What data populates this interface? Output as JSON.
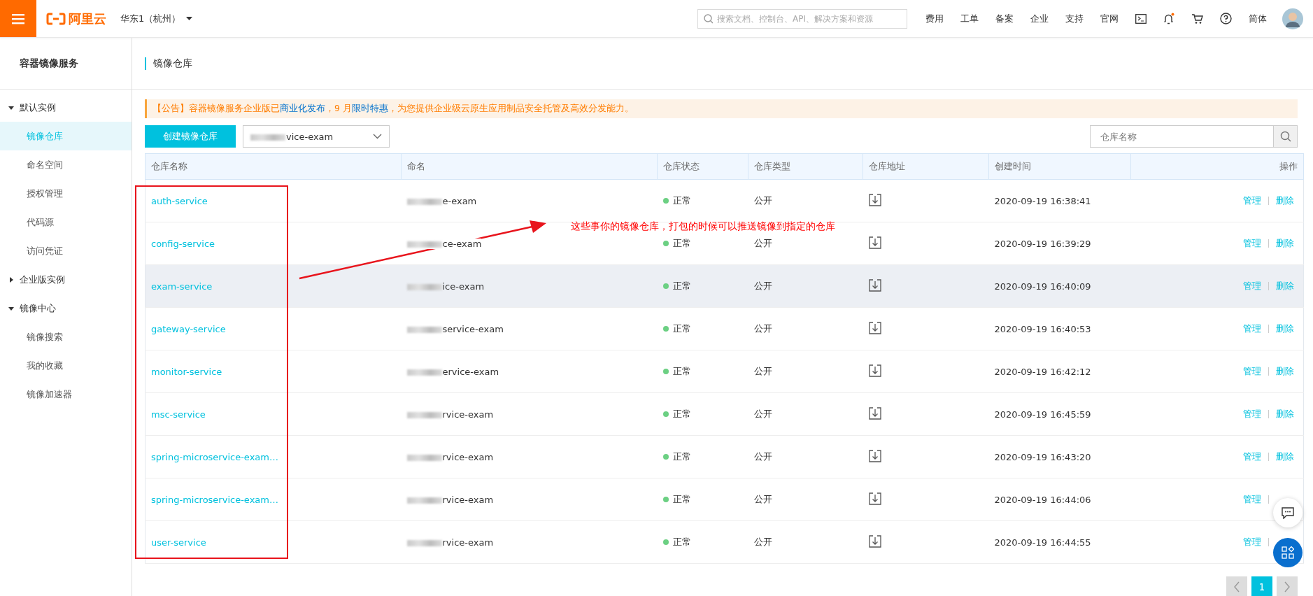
{
  "topbar": {
    "logo_text": "阿里云",
    "region": "华东1（杭州）",
    "search": {
      "placeholder": "搜索文档、控制台、API、解决方案和资源"
    },
    "links": [
      "费用",
      "工单",
      "备案",
      "企业",
      "支持",
      "官网"
    ],
    "language": "简体"
  },
  "sidebar": {
    "title": "容器镜像服务",
    "groups": [
      {
        "label": "默认实例",
        "expanded": true,
        "children": [
          {
            "label": "镜像仓库",
            "selected": true
          },
          {
            "label": "命名空间",
            "selected": false
          },
          {
            "label": "授权管理",
            "selected": false
          },
          {
            "label": "代码源",
            "selected": false
          },
          {
            "label": "访问凭证",
            "selected": false
          }
        ]
      },
      {
        "label": "企业版实例",
        "expanded": false
      },
      {
        "label": "镜像中心",
        "expanded": true,
        "children": [
          {
            "label": "镜像搜索",
            "selected": false
          },
          {
            "label": "我的收藏",
            "selected": false
          },
          {
            "label": "镜像加速器",
            "selected": false
          }
        ]
      }
    ]
  },
  "page_title": "镜像仓库",
  "notice": "【公告】容器镜像服务企业版已**商业化发布**，9 月**限时特惠**，为您提供企业级云原生应用制品安全托管及高效分发能力。",
  "create_button": "创建镜像仓库",
  "namespace_select": {
    "value": "vice-exam"
  },
  "repo_search": {
    "placeholder": "仓库名称"
  },
  "table": {
    "columns": [
      "仓库名称",
      "命名",
      "仓库状态",
      "仓库类型",
      "仓库地址",
      "创建时间",
      "操作"
    ],
    "rows": [
      {
        "name": "auth-service",
        "namespace": "e-exam",
        "status": "正常",
        "type": "公开",
        "created": "2020-09-19 16:38:41",
        "actions": [
          "管理",
          "删除"
        ],
        "hovered": false
      },
      {
        "name": "config-service",
        "namespace": "ce-exam",
        "status": "正常",
        "type": "公开",
        "created": "2020-09-19 16:39:29",
        "actions": [
          "管理",
          "删除"
        ],
        "hovered": false
      },
      {
        "name": "exam-service",
        "namespace": "ice-exam",
        "status": "正常",
        "type": "公开",
        "created": "2020-09-19 16:40:09",
        "actions": [
          "管理",
          "删除"
        ],
        "hovered": true
      },
      {
        "name": "gateway-service",
        "namespace": "service-exam",
        "status": "正常",
        "type": "公开",
        "created": "2020-09-19 16:40:53",
        "actions": [
          "管理",
          "删除"
        ],
        "hovered": false
      },
      {
        "name": "monitor-service",
        "namespace": "ervice-exam",
        "status": "正常",
        "type": "公开",
        "created": "2020-09-19 16:42:12",
        "actions": [
          "管理",
          "删除"
        ],
        "hovered": false
      },
      {
        "name": "msc-service",
        "namespace": "rvice-exam",
        "status": "正常",
        "type": "公开",
        "created": "2020-09-19 16:45:59",
        "actions": [
          "管理",
          "删除"
        ],
        "hovered": false
      },
      {
        "name": "spring-microservice-exam…",
        "namespace": "rvice-exam",
        "status": "正常",
        "type": "公开",
        "created": "2020-09-19 16:43:20",
        "actions": [
          "管理",
          "删除"
        ],
        "hovered": false
      },
      {
        "name": "spring-microservice-exam…",
        "namespace": "rvice-exam",
        "status": "正常",
        "type": "公开",
        "created": "2020-09-19 16:44:06",
        "actions": [
          "管理"
        ],
        "hovered": false
      },
      {
        "name": "user-service",
        "namespace": "rvice-exam",
        "status": "正常",
        "type": "公开",
        "created": "2020-09-19 16:44:55",
        "actions": [
          "管理"
        ],
        "hovered": false
      }
    ]
  },
  "pagination": [
    {
      "label": "1",
      "selected": true
    }
  ],
  "annotation": "这些事你的镜像仓库，打包的时候可以推送镜像到指定的仓库"
}
